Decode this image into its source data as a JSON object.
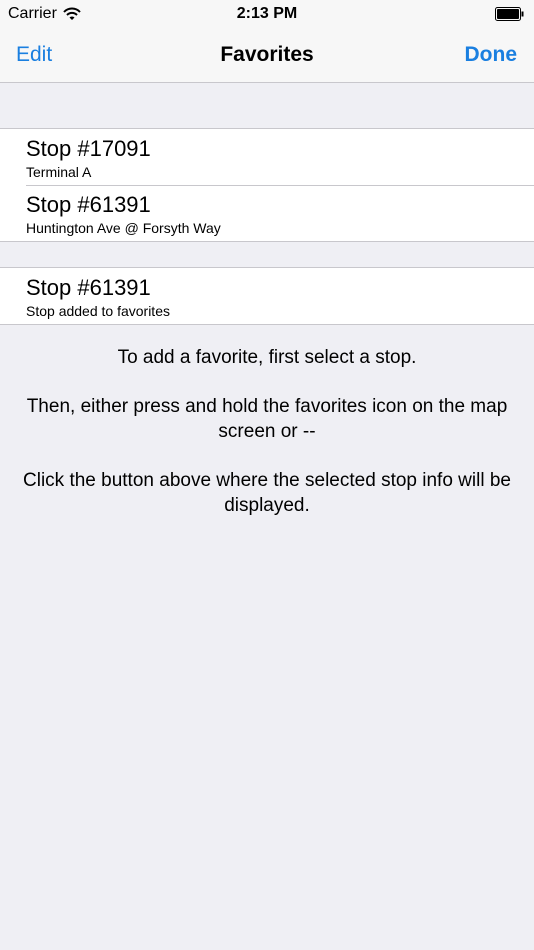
{
  "status_bar": {
    "carrier": "Carrier",
    "time": "2:13 PM",
    "wifi_icon": "wifi-icon",
    "battery_icon": "battery-full-icon"
  },
  "nav": {
    "edit_label": "Edit",
    "title": "Favorites",
    "done_label": "Done",
    "accent_color": "#1a7fe0"
  },
  "favorites": [
    {
      "title": "Stop #17091",
      "subtitle": "Terminal A"
    },
    {
      "title": "Stop #61391",
      "subtitle": "Huntington Ave @ Forsyth Way"
    }
  ],
  "selected_stop": {
    "title": "Stop #61391",
    "subtitle": "Stop added to favorites"
  },
  "instructions": [
    "To add a favorite, first select a stop.",
    "Then, either press and hold the favorites icon on the map screen or --",
    "Click the button above where the selected stop info will be displayed."
  ],
  "colors": {
    "background": "#efeff4",
    "separator": "#c8c7cc",
    "bar": "#f7f7f7"
  }
}
